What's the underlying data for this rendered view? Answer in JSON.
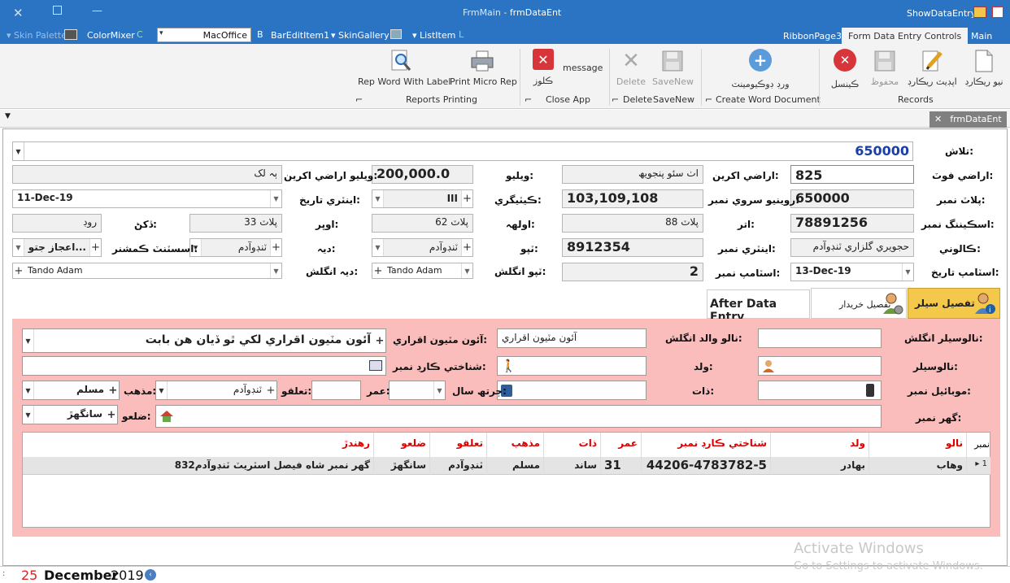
{
  "window": {
    "title_center": "FrmMain - frmDataEnt",
    "title_app": "FrmMain",
    "title_form": "frmDataEnt",
    "right_label": "ShowDataEntry"
  },
  "qat": {
    "skin_palette": "Skin Palette",
    "color_mixer": "ColorMixer",
    "skin_value": "MacOffice",
    "bar_edit": "BarEditItem1",
    "skin_gallery": "SkinGallery",
    "list_item": "ListItem"
  },
  "tabs": [
    "RibbonPage3",
    "Form Data Entry Controls",
    "Main"
  ],
  "ribbon": {
    "rep_word": "Rep Word With Label",
    "print_micro": "Print Micro Rep",
    "reports_group": "Reports Printing",
    "close_btn": "ڪلوز",
    "message": "message",
    "close_group": "Close App",
    "delete": "Delete",
    "savenew": "SaveNew",
    "delete_group": "Delete",
    "savenew_group": "SaveNew",
    "word_doc": "ورڊ ڊوڪيومينٽ",
    "word_group": "Create Word Document",
    "cancel": "ڪينسل",
    "saved": "محفوظ",
    "update": "اپڊيٽ ريڪارڊ",
    "new_rec": "نيو ريڪارڊ",
    "records_group": "Records"
  },
  "doc_tab": "frmDataEnt",
  "form": {
    "search_label": "تلاش:",
    "search_value": "650000",
    "land_ft_label": "اراضي فوٽ:",
    "land_ft_value": "825",
    "land_acre_label": "اراضي اکرين:",
    "land_acre_value": "اٺ سئو پنجويھ",
    "value_label": "ويليو:",
    "value_land_label": "ويليو اراضي اکرين:",
    "value_amount": "200,000.0",
    "value_words": "ٻہ لک",
    "plot_label": "پلاٽ نمبر:",
    "plot_value": "650000",
    "survey_label": "روينيو سروي نمبر:",
    "survey_value": "103,109,108",
    "category_label": "ڪيٽيگري:",
    "category_value": "III",
    "entry_date_label": "اينٽري تاريخ:",
    "entry_date": "11-Dec-19",
    "scan_label": "اسڪيننگ نمبر:",
    "scan_value": "78891256",
    "near_label": "اتر:",
    "near_value": "پلاٽ 88",
    "south_label": "اولهہ:",
    "south_value": "پلاٽ 62",
    "up_label": "اوڀر:",
    "up_value": "پلاٽ 33",
    "dakhan_label": "ڏکڻ:",
    "dakhan_value": "روڊ",
    "colony_label": "ڪالوني:",
    "colony_value": "حجويري گلزاري ٽنڊوآدم",
    "entry_no_label": "اينٽري نمبر:",
    "entry_no": "8912354",
    "tapo_label": "ٽپو:",
    "tapo_value": "ٽنڊوآدم",
    "deh_label": "ديہ:",
    "deh_value": "ٽنڊوآدم",
    "asst_label": "اسسٽنٽ ڪمشنر:",
    "asst_value": "اعجاز جتو...",
    "stamp_date_label": "اسٽامپ تاريخ:",
    "stamp_date": "13-Dec-19",
    "stamp_no_label": "اسٽامپ نمبر:",
    "stamp_no": "2",
    "tapo_en_label": "ٽپو انگلش:",
    "tapo_en": "Tando Adam",
    "deh_en_label": "ديہ انگلش:",
    "deh_en": "Tando Adam"
  },
  "subtabs": {
    "seller": "تفصيل سيلر",
    "buyer": "تفصيل خريدار",
    "after": "After Data Entry"
  },
  "seller": {
    "name_en_label": "نالوسيلر انگلش:",
    "father_en_label": "نالو والد انگلش:",
    "agreement_label": "آئون مٽيون اقراري:",
    "agreement_box": "آئون مٽيون اقراري",
    "agreement_value": "آئون مٽيون اقراري لکي ٿو ڏيان ھن بابت",
    "name_label": "نالوسيلر:",
    "father_label": "ولد:",
    "cnic_label": "شناختي ڪارڊ نمبر:",
    "mobile_label": "موبائيل نمبر:",
    "caste_label": "ذات:",
    "birth_label": "ڄرتھ سال:",
    "age_label": "عمر:",
    "taluka_label": "تعلقو:",
    "taluka_value": "ٽنڊوآدم",
    "religion_label": "مذهب:",
    "religion_value": "مسلم",
    "house_label": "گهر نمبر:",
    "district_label": "ضلعو:",
    "district_value": "سانگھڙ"
  },
  "grid": {
    "headers": {
      "no": "نمبر",
      "name": "نالو",
      "father": "ولد",
      "cnic": "شناختي ڪارڊ نمبر",
      "age": "عمر",
      "caste": "ذات",
      "religion": "مذهب",
      "taluka": "تعلقو",
      "district": "ضلعو",
      "resident": "رهندڙ"
    },
    "row": {
      "no": "1",
      "name": "وهاب",
      "father": "بهادر",
      "cnic": "44206-4783782-5",
      "age": "31",
      "caste": "ساند",
      "religion": "مسلم",
      "taluka": "ٽنڊوآدم",
      "district": "سانگھڙ",
      "resident": "832گهر نمبر شاه فيصل اسٽريٽ ٽنڊوآدم"
    }
  },
  "status": {
    "day": "25",
    "month": "December",
    "year": "2019"
  },
  "watermark": {
    "line1": "Activate Windows",
    "line2": "Go to Settings to activate Windows."
  }
}
